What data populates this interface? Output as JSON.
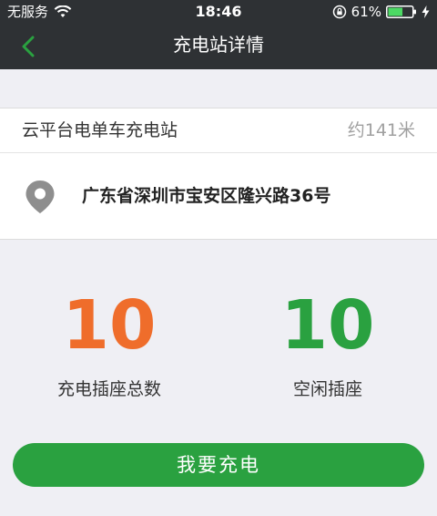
{
  "status_bar": {
    "carrier": "无服务",
    "time": "18:46",
    "battery": "61%",
    "battery_level": 0.61
  },
  "nav": {
    "title": "充电站详情"
  },
  "station": {
    "name": "云平台电单车充电站",
    "distance": "约141米",
    "address": "广东省深圳市宝安区隆兴路36号"
  },
  "stats": {
    "total_value": "10",
    "total_label": "充电插座总数",
    "free_value": "10",
    "free_label": "空闲插座"
  },
  "action": {
    "charge_label": "我要充电"
  },
  "colors": {
    "topbar": "#2e3134",
    "accent_green": "#2aa140",
    "accent_orange": "#ef6d2b"
  }
}
